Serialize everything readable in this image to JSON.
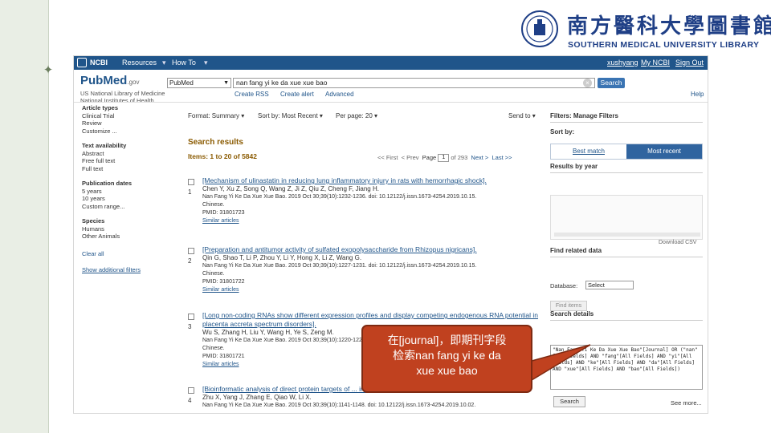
{
  "logo": {
    "cn": "南方醫科大學圖書館",
    "en": "SOUTHERN MEDICAL UNIVERSITY LIBRARY"
  },
  "ncbi": {
    "brand": "NCBI",
    "resources": "Resources",
    "howto": "How To",
    "user": "xushyang",
    "myncbi": "My NCBI",
    "signout": "Sign Out"
  },
  "pubmed": {
    "logo": "PubMed",
    "logo_sub": ".gov",
    "tagline": "US National Library of Medicine National Institutes of Health"
  },
  "search": {
    "db": "PubMed",
    "query": "nan fang yi ke da xue xue bao",
    "button": "Search",
    "create_rss": "Create RSS",
    "create_alert": "Create alert",
    "advanced": "Advanced",
    "help": "Help"
  },
  "filters": {
    "article_types": "Article types",
    "clinical_trial": "Clinical Trial",
    "review": "Review",
    "customize": "Customize ...",
    "text_avail": "Text availability",
    "abstract": "Abstract",
    "free_full": "Free full text",
    "full_text": "Full text",
    "pub_dates": "Publication dates",
    "y5": "5 years",
    "y10": "10 years",
    "custom_range": "Custom range...",
    "species": "Species",
    "humans": "Humans",
    "other_animals": "Other Animals",
    "clear_all": "Clear all",
    "show_additional": "Show additional filters"
  },
  "toolbar": {
    "format": "Format: Summary ▾",
    "sort": "Sort by: Most Recent ▾",
    "perpage": "Per page: 20 ▾",
    "sendto": "Send to ▾"
  },
  "results": {
    "heading": "Search results",
    "count": "Items: 1 to 20 of 5842",
    "first": "<< First",
    "prev": "< Prev",
    "page_label": "Page",
    "page": "1",
    "of": "of 293",
    "next": "Next >",
    "last": "Last >>",
    "items": [
      {
        "num": "1",
        "title": "[Mechanism of ulinastatin in reducing lung inflammatory injury in rats with hemorrhagic shock].",
        "authors": "Chen Y, Xu Z, Song Q, Wang Z, Ji Z, Qiu Z, Cheng F, Jiang H.",
        "cite": "Nan Fang Yi Ke Da Xue Xue Bao. 2019 Oct 30;39(10):1232-1236. doi: 10.12122/j.issn.1673-4254.2019.10.15.",
        "lang": "Chinese.",
        "pmid": "PMID: 31801723",
        "similar": "Similar articles"
      },
      {
        "num": "2",
        "title": "[Preparation and antitumor activity of sulfated exopolysaccharide from Rhizopus nigricans].",
        "authors": "Qin G, Shao T, Li P, Zhou Y, Li Y, Hong X, Li Z, Wang G.",
        "cite": "Nan Fang Yi Ke Da Xue Xue Bao. 2019 Oct 30;39(10):1227-1231. doi: 10.12122/j.issn.1673-4254.2019.10.15.",
        "lang": "Chinese.",
        "pmid": "PMID: 31801722",
        "similar": "Similar articles"
      },
      {
        "num": "3",
        "title": "[Long non-coding RNAs show different expression profiles and display competing endogenous RNA potential in placenta accreta spectrum disorders].",
        "authors": "Wu S, Zhang H, Liu Y, Wang H, Ye S, Zeng M.",
        "cite": "Nan Fang Yi Ke Da Xue Xue Bao. 2019 Oct 30;39(10):1220-1226.",
        "lang": "Chinese.",
        "pmid": "PMID: 31801721",
        "similar": "Similar articles"
      },
      {
        "num": "4",
        "title": "[Bioinformatic analysis of direct protein targets of ... in hepatocellular carcinoma].",
        "authors": "Zhu X, Yang J, Zhang E, Qiao W, Li X.",
        "cite": "Nan Fang Yi Ke Da Xue Xue Bao. 2019 Oct 30;39(10):1141-1148. doi: 10.12122/j.issn.1673-4254.2019.10.02.",
        "lang": "",
        "pmid": "",
        "similar": ""
      }
    ]
  },
  "right": {
    "filters": "Filters: Manage Filters",
    "sort_by": "Sort by:",
    "best_match": "Best match",
    "most_recent": "Most recent",
    "results_by_year": "Results by year",
    "download_csv": "Download CSV",
    "find_related": "Find related data",
    "database_label": "Database:",
    "database_value": "Select",
    "find_items": "Find items",
    "search_details": "Search details",
    "details_text": "\"Nan Fang Yi Ke Da Xue Xue Bao\"[Journal] OR (\"nan\"[All Fields] AND \"fang\"[All Fields] AND \"yi\"[All Fields] AND \"ke\"[All Fields] AND \"da\"[All Fields] AND \"xue\"[All Fields] AND \"bao\"[All Fields])",
    "search_btn": "Search",
    "see_more": "See more..."
  },
  "callout": {
    "line1": "在[journal]，即期刊字段",
    "line2": "检索nan fang yi ke da",
    "line3": "xue xue bao"
  },
  "colors": {
    "ncbi_bar": "#20558a",
    "callout": "#c0411f",
    "sort_active": "#30649f"
  }
}
